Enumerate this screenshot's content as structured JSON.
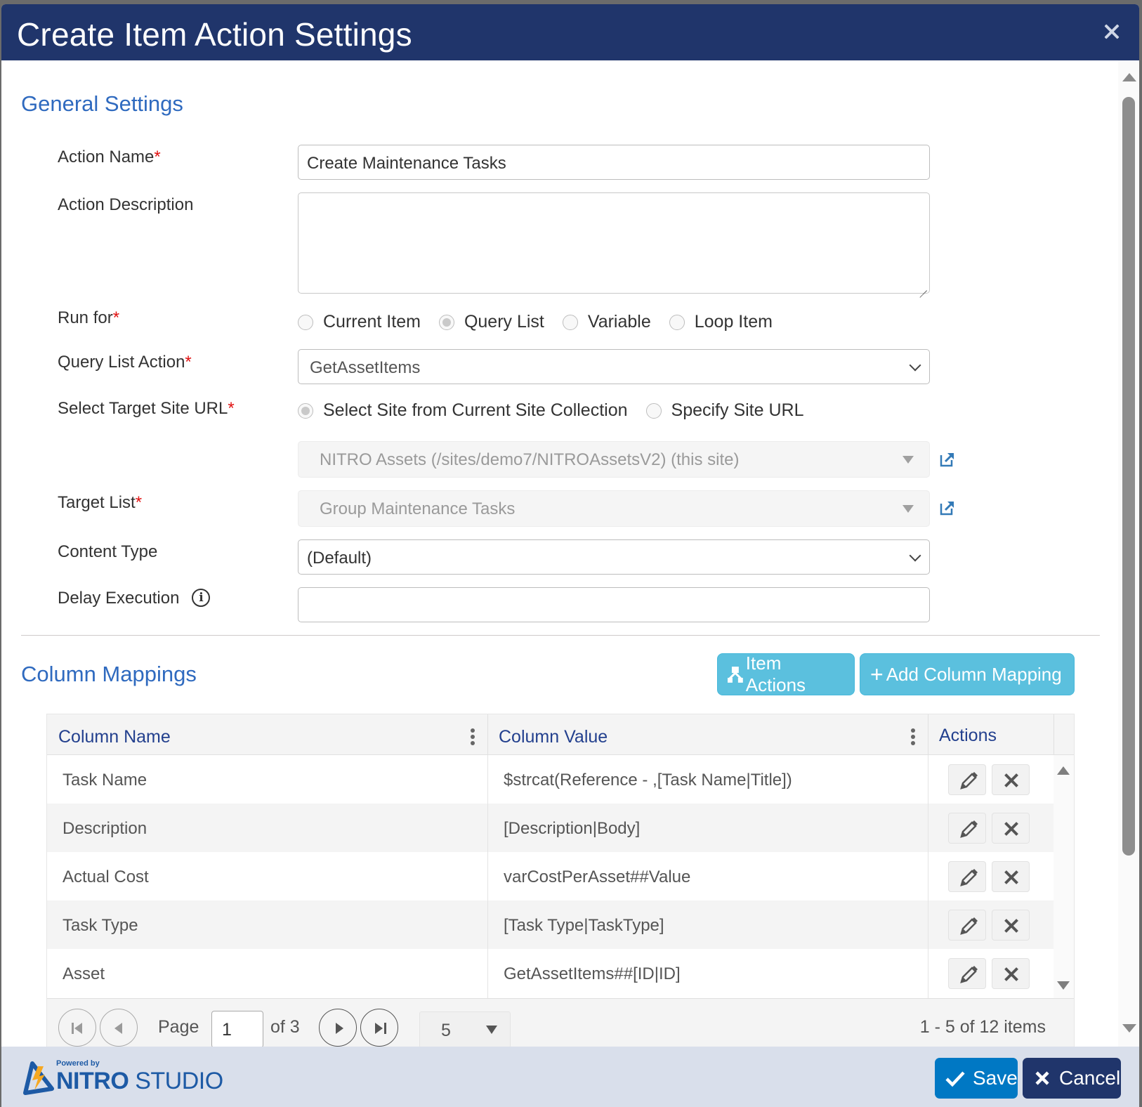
{
  "dialog": {
    "title": "Create Item Action Settings",
    "close_icon": "close-icon"
  },
  "general": {
    "heading": "General Settings",
    "action_name": {
      "label": "Action Name",
      "required": true,
      "value": "Create Maintenance Tasks"
    },
    "action_description": {
      "label": "Action Description",
      "value": ""
    },
    "run_for": {
      "label": "Run for",
      "required": true,
      "options": [
        "Current Item",
        "Query List",
        "Variable",
        "Loop Item"
      ],
      "selected": "Query List"
    },
    "query_list_action": {
      "label": "Query List Action",
      "required": true,
      "value": "GetAssetItems"
    },
    "target_site_url": {
      "label": "Select Target Site URL",
      "required": true,
      "options": [
        "Select Site from Current Site Collection",
        "Specify Site URL"
      ],
      "selected": "Select Site from Current Site Collection",
      "site_value": "NITRO Assets (/sites/demo7/NITROAssetsV2) (this site)"
    },
    "target_list": {
      "label": "Target List",
      "required": true,
      "value": "Group Maintenance Tasks"
    },
    "content_type": {
      "label": "Content Type",
      "value": "(Default)"
    },
    "delay_execution": {
      "label": "Delay Execution",
      "value": ""
    },
    "required_marker": "*"
  },
  "mappings": {
    "heading": "Column Mappings",
    "item_actions_label": "Item Actions",
    "add_mapping_label": "Add Column Mapping",
    "columns": [
      "Column Name",
      "Column Value",
      "Actions"
    ],
    "rows": [
      {
        "name": "Task Name",
        "value": "$strcat(Reference - ,[Task Name|Title])"
      },
      {
        "name": "Description",
        "value": "[Description|Body]"
      },
      {
        "name": "Actual Cost",
        "value": "varCostPerAsset##Value"
      },
      {
        "name": "Task Type",
        "value": "[Task Type|TaskType]"
      },
      {
        "name": "Asset",
        "value": "GetAssetItems##[ID|ID]"
      }
    ],
    "pager": {
      "page_label": "Page",
      "current_page": "1",
      "of_label": "of 3",
      "page_size": "5",
      "items_info": "1 - 5 of 12 items"
    }
  },
  "footer": {
    "powered_by": "Powered by",
    "brand_bold": "NITRO",
    "brand_light": "STUDIO",
    "save_label": "Save",
    "cancel_label": "Cancel"
  },
  "colors": {
    "titlebar": "#20356b",
    "section_heading": "#2f6abf",
    "info_button": "#5bc0de",
    "save_button": "#0078c4",
    "cancel_button": "#20356b",
    "required": "#e01010",
    "footer_bg": "#d9dfeb"
  }
}
